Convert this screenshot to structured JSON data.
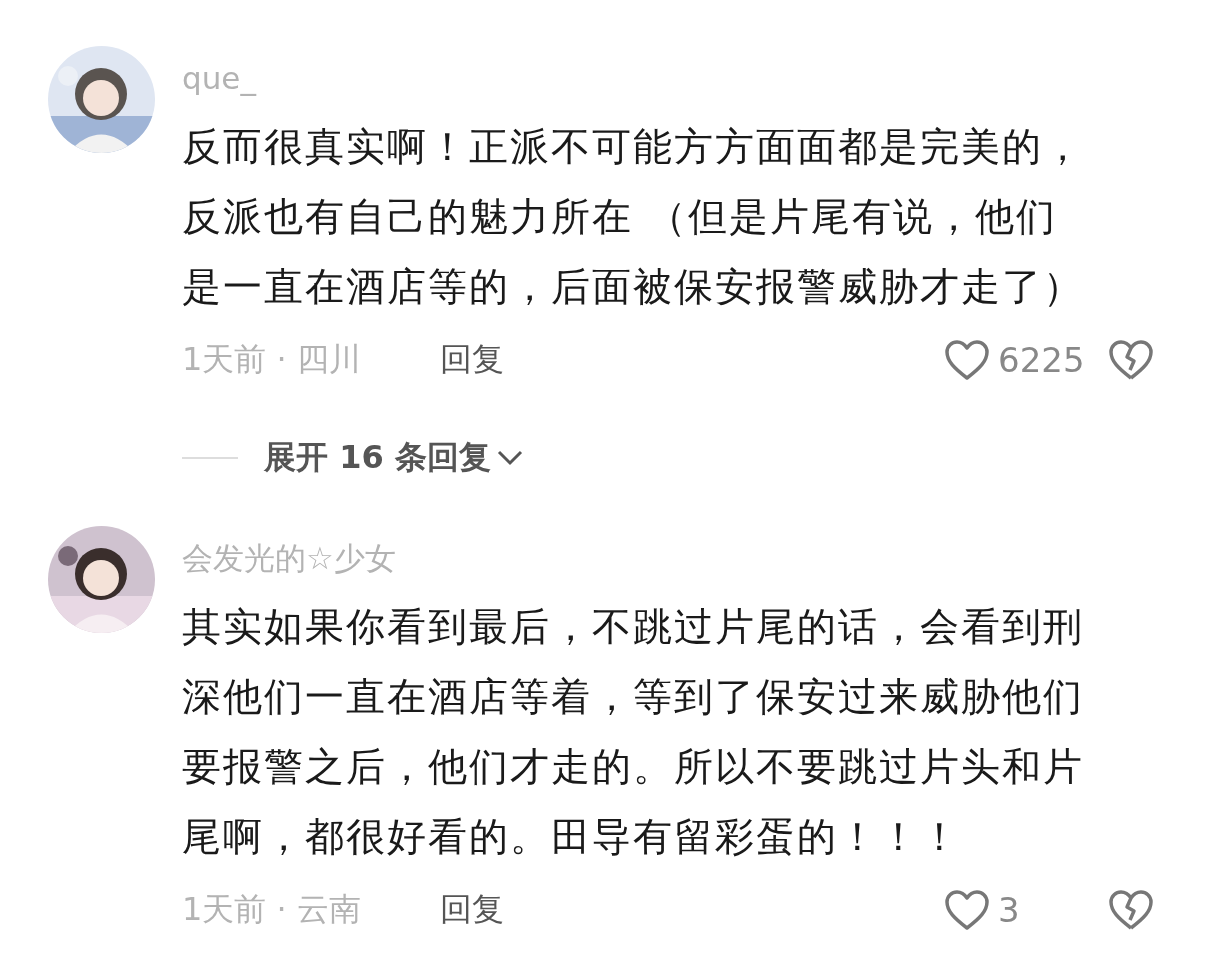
{
  "comments": [
    {
      "username": "que_",
      "avatar": {
        "kind": "picture"
      },
      "lines": [
        "反而很真实啊！正派不可能方方面面都是完美的，",
        "反派也有自己的魅力所在 （但是片尾有说，他们",
        "是一直在酒店等的，后面被保安报警威胁才走了）"
      ],
      "meta": "1天前 · 四川",
      "reply": "回复",
      "likes": "6225",
      "expand_replies": "展开 16 条回复"
    },
    {
      "username": "会发光的☆少女",
      "avatar": {
        "kind": "picture"
      },
      "lines": [
        "其实如果你看到最后，不跳过片尾的话，会看到刑",
        "深他们一直在酒店等着，等到了保安过来威胁他们",
        "要报警之后，他们才走的。所以不要跳过片头和片",
        "尾啊，都很好看的。田导有留彩蛋的！！！"
      ],
      "meta": "1天前 · 云南",
      "reply": "回复",
      "likes": "3"
    }
  ]
}
